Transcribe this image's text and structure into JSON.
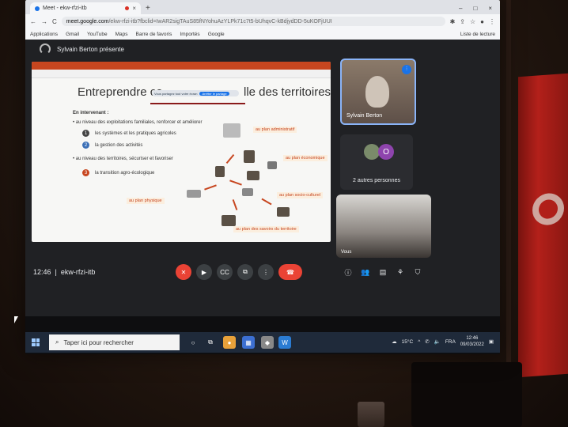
{
  "browser": {
    "tab_title": "Meet - ekw-rfzi-itb",
    "new_tab": "+",
    "window_controls": [
      "–",
      "□",
      "×"
    ],
    "url_host": "meet.google.com",
    "url_path": "/ekw-rfzi-itb?fbclid=IwAR2sigTAuS85fNYohuAzYLPk71c7t5-bUhqvC-kBdjydDD-5uKOFjUUI",
    "bookmarks": [
      "Applications",
      "Gmail",
      "YouTube",
      "Maps",
      "Barre de favoris",
      "Importés",
      "Google"
    ],
    "reading_list": "Liste de lecture"
  },
  "meet": {
    "presenter_label": "Sylvain Berton présente",
    "meeting_time": "12:46",
    "meeting_code": "ekw-rfzi-itb",
    "participant_name": "Sylvain Berton",
    "others_avatar_letter": "O",
    "others_label": "2 autres personnes",
    "self_label": "Vous",
    "colors": {
      "accent": "#1a73e8",
      "hangup": "#ea4335",
      "bg": "#202124"
    }
  },
  "slide": {
    "title_left": "Entreprendre co",
    "sharing_notice": "Vous partagez tout votre écran",
    "stop_sharing": "Arrêter le partage",
    "title_right": "lle des territoires",
    "intro": "En intervenant :",
    "bullet1": "• au niveau des exploitations familiales, renforcer et améliorer",
    "item1": "les systèmes et les pratiques agricoles",
    "item2": "la gestion des activités",
    "bullet2": "• au niveau des territoires, sécuriser et favoriser",
    "item3": "la transition agro-écologique",
    "labels": {
      "admin": "au plan administratif",
      "eco": "au plan économique",
      "socio": "au plan socio-culturel",
      "physique": "au plan physique",
      "savoirs": "au plan des savoirs du territoire"
    }
  },
  "taskbar": {
    "search_placeholder": "Taper ici pour rechercher",
    "temperature": "15°C",
    "language": "FRA",
    "time": "12:46",
    "date": "09/03/2022"
  }
}
